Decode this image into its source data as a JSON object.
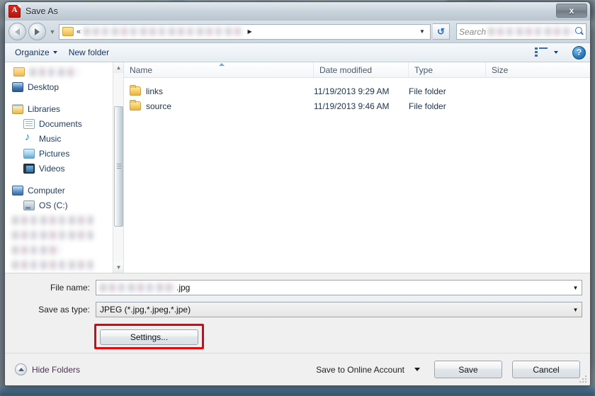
{
  "window": {
    "title": "Save As",
    "app_icon": "pdf-icon",
    "close_label": "x"
  },
  "navbar": {
    "back_icon": "back-arrow-icon",
    "forward_icon": "forward-arrow-icon",
    "history_icon": "chevron-down-icon",
    "address_folder_icon": "folder-icon",
    "address_overflow": "«",
    "address_path_redacted": true,
    "address_separator": "▸",
    "address_dropdown_icon": "chevron-down-icon",
    "refresh_icon": "refresh-icon",
    "search": {
      "placeholder": "Search",
      "location_redacted": true,
      "icon": "search-icon"
    }
  },
  "commandbar": {
    "organize_label": "Organize",
    "organize_caret_icon": "chevron-down-icon",
    "new_folder_label": "New folder",
    "view_icon": "view-list-icon",
    "view_caret_icon": "chevron-down-icon",
    "help_label": "?",
    "help_icon": "help-icon"
  },
  "navpane": {
    "items": [
      {
        "label": "",
        "icon": "folder-icon",
        "redacted": true,
        "indent": false
      },
      {
        "label": "Desktop",
        "icon": "desktop-icon",
        "redacted": false,
        "indent": false
      },
      {
        "label": "Libraries",
        "icon": "libraries-icon",
        "redacted": false,
        "indent": false
      },
      {
        "label": "Documents",
        "icon": "documents-icon",
        "redacted": false,
        "indent": true
      },
      {
        "label": "Music",
        "icon": "music-icon",
        "redacted": false,
        "indent": true
      },
      {
        "label": "Pictures",
        "icon": "pictures-icon",
        "redacted": false,
        "indent": true
      },
      {
        "label": "Videos",
        "icon": "videos-icon",
        "redacted": false,
        "indent": true
      },
      {
        "label": "Computer",
        "icon": "computer-icon",
        "redacted": false,
        "indent": false
      },
      {
        "label": "OS (C:)",
        "icon": "drive-icon",
        "redacted": false,
        "indent": true
      }
    ],
    "redacted_items_count": 4,
    "scrollbar": {
      "up_icon": "scroll-up-icon",
      "down_icon": "scroll-down-icon"
    }
  },
  "filelist": {
    "columns": [
      "Name",
      "Date modified",
      "Type",
      "Size"
    ],
    "sorted_column": "Name",
    "sort_direction": "ascending",
    "rows": [
      {
        "name": "links",
        "date_modified": "11/19/2013 9:29 AM",
        "type": "File folder",
        "size": "",
        "icon": "folder-icon"
      },
      {
        "name": "source",
        "date_modified": "11/19/2013 9:46 AM",
        "type": "File folder",
        "size": "",
        "icon": "folder-icon"
      }
    ]
  },
  "form": {
    "file_name_label": "File name:",
    "file_name_value_extension": ".jpg",
    "file_name_redacted": true,
    "file_name_caret_icon": "chevron-down-icon",
    "save_as_type_label": "Save as type:",
    "save_as_type_value": "JPEG (*.jpg,*.jpeg,*.jpe)",
    "save_as_type_caret_icon": "chevron-down-icon",
    "settings_label": "Settings...",
    "settings_highlight_color": "#e8000d"
  },
  "footer": {
    "hide_folders_label": "Hide Folders",
    "hide_folders_icon": "collapse-up-icon",
    "online_account_label": "Save to Online Account",
    "online_account_caret_icon": "chevron-down-icon",
    "save_label": "Save",
    "cancel_label": "Cancel",
    "resize_grip_icon": "resize-grip-icon"
  }
}
